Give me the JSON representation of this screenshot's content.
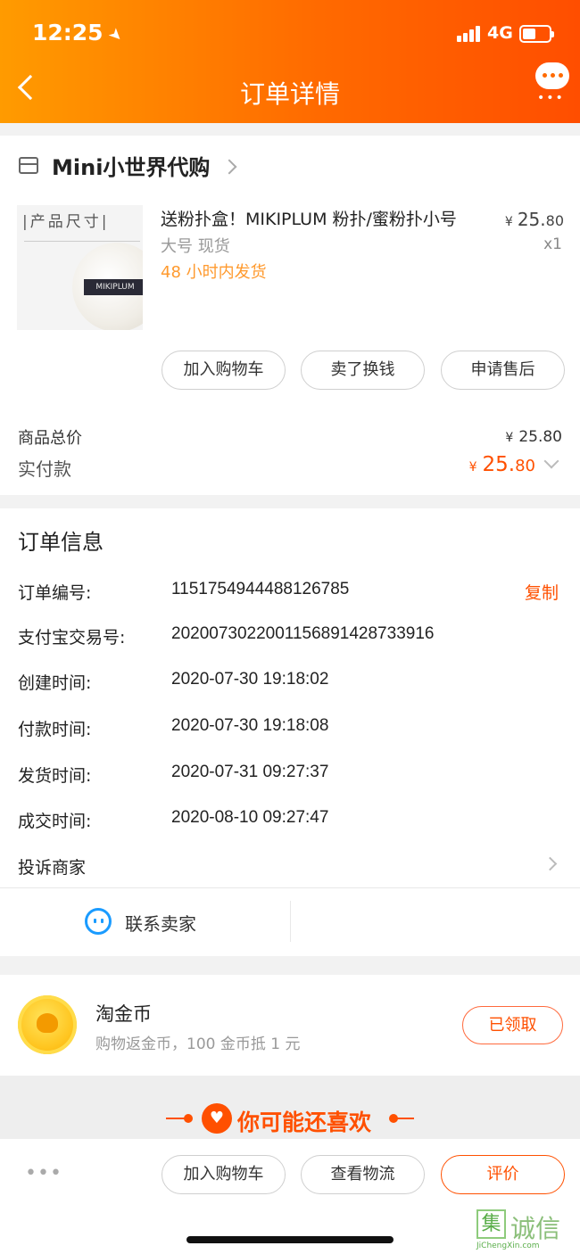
{
  "status": {
    "time": "12:25",
    "network": "4G"
  },
  "header": {
    "title": "订单详情"
  },
  "shop": {
    "name": "Mini小世界代购"
  },
  "product": {
    "image_text": "|产品尺寸|",
    "image_brand": "MIKIPLUM",
    "title": "送粉扑盒！MIKIPLUM 粉扑/蜜粉扑小号",
    "sku": "大号 现货",
    "shipping": "48 小时内发货",
    "price_currency": "¥",
    "price_int": "25.",
    "price_dec": "80",
    "quantity": "x1"
  },
  "actions": {
    "add_cart": "加入购物车",
    "resell": "卖了换钱",
    "after_sale": "申请售后"
  },
  "summary": {
    "total_label": "商品总价",
    "total_currency": "¥",
    "total_value": "25.80",
    "paid_label": "实付款",
    "paid_currency": "¥",
    "paid_int": "25.",
    "paid_dec": "80"
  },
  "order_info": {
    "title": "订单信息",
    "copy_label": "复制",
    "rows": [
      {
        "label": "订单编号:",
        "value": "1151754944488126785"
      },
      {
        "label": "支付宝交易号:",
        "value": "2020073022001156891428733916"
      },
      {
        "label": "创建时间:",
        "value": "2020-07-30 19:18:02"
      },
      {
        "label": "付款时间:",
        "value": "2020-07-30 19:18:08"
      },
      {
        "label": "发货时间:",
        "value": "2020-07-31 09:27:37"
      },
      {
        "label": "成交时间:",
        "value": "2020-08-10 09:27:47"
      }
    ],
    "complaint": "投诉商家",
    "contact_seller": "联系卖家"
  },
  "coins": {
    "title": "淘金币",
    "desc": "购物返金币，100 金币抵 1 元",
    "button": "已领取"
  },
  "recommend": {
    "title": "你可能还喜欢"
  },
  "bottom": {
    "add_cart": "加入购物车",
    "logistics": "查看物流",
    "rate": "评价"
  },
  "watermark": {
    "text": "诚信",
    "url": "JiChengXin.com"
  },
  "colors": {
    "accent": "#ff5000",
    "header_start": "#ff9b00",
    "header_end": "#ff4e00",
    "ship_orange": "#ff9a2e",
    "contact_blue": "#1a9bff"
  }
}
